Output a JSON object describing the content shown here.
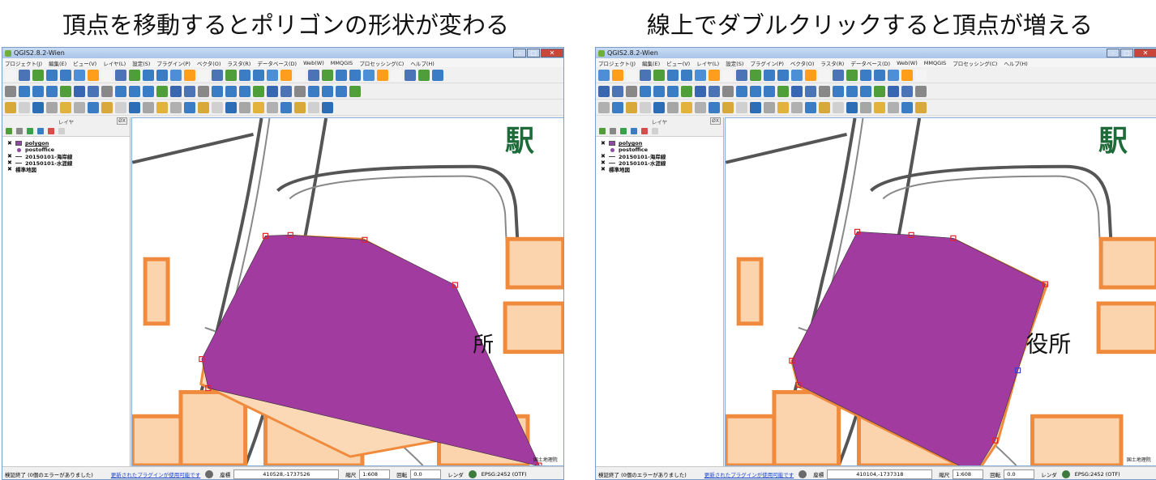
{
  "captions": {
    "left": "頂点を移動するとポリゴンの形状が変わる",
    "right": "線上でダブルクリックすると頂点が増える"
  },
  "window": {
    "title": "QGIS2.8.2-Wien",
    "menu": [
      "プロジェクト(J)",
      "編集(E)",
      "ビュー(V)",
      "レイヤ(L)",
      "設定(S)",
      "プラグイン(P)",
      "ベクタ(O)",
      "ラスタ(R)",
      "データベース(D)",
      "Web(W)",
      "MMQGIS",
      "プロセッシング(C)",
      "ヘルプ(H)"
    ],
    "toolbar_colors": [
      "#f4f4f4",
      "#e2b33c",
      "#4a74b5",
      "#4a74b5",
      "#b0b0b0",
      "#888888",
      "#4f9e3a",
      "#3b7dc4",
      "#3b7dc4",
      "#3b7dc4",
      "#d8a83a",
      "#3b7dc4",
      "#3b7dc4",
      "#d0d0d0",
      "#3b7dc4",
      "#4c8fd6",
      "#2d6db6",
      "#4f9e3a",
      "#ff9e1a",
      "#a6a6a6",
      "#3966b0"
    ],
    "layers_panel": {
      "title": "レイヤ",
      "close_label": "ØX",
      "layers": [
        {
          "name": "polygon",
          "checked": "✖",
          "symbol_color": "#8f48a3"
        },
        {
          "name": "postoffice",
          "checked": "",
          "symbol_color": "#8f48a3"
        },
        {
          "name": "20150101-海岸線",
          "checked": "✖",
          "symbol_color": "#444444"
        },
        {
          "name": "20150101-水涯線",
          "checked": "✖",
          "symbol_color": "#444444"
        },
        {
          "name": "標準地図",
          "checked": "✖",
          "symbol_color": "#ffffff"
        }
      ]
    },
    "map": {
      "station_label": "駅",
      "office_label_left": "所",
      "office_label_right": "役所",
      "credit": "国土地理院",
      "polygon_fill": "#a23ba0",
      "vertex_color": "#e0232a",
      "new_vertex_color": "#3b3bd6"
    },
    "status": {
      "message": "検証終了 (0個のエラーがありました)",
      "plugin_link": "更新されたプラグインが使用可能です",
      "coord_label": "座標",
      "coord_left": "410528,-1737526",
      "coord_right": "410104,-1737318",
      "scale_label": "縮尺",
      "scale_value": "1:608",
      "rotation_label": "回転",
      "rotation_value": "0.0",
      "render_label": "レンダ",
      "crs": "EPSG:2452 (OTF)"
    }
  }
}
